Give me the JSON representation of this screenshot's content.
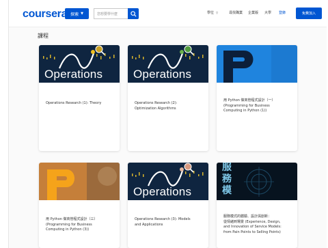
{
  "header": {
    "logo": "coursera",
    "explore_label": "探索",
    "search_placeholder": "您想要學什麼",
    "nav": [
      "學位",
      "尋找職業",
      "企業版",
      "大學",
      "登錄"
    ],
    "join_label": "免費加入"
  },
  "section": {
    "title": "課程"
  },
  "thumb_text": {
    "operations": "Operations",
    "cjk_chars": [
      "服",
      "務",
      "模"
    ]
  },
  "courses": [
    {
      "title": "Operations Research (1): Theory"
    },
    {
      "title": "Operations Research (2):\nOptimization Algorithms"
    },
    {
      "title": "用 Python 做商管程式設計（一）\n(Programming for Business\nComputing in Python (1))"
    },
    {
      "title": "用 Python 做商管程式設計（三）\n(Programming for Business\nComputing in Python (3))"
    },
    {
      "title": "Operations Research (3): Models\nand Applications"
    },
    {
      "title": "服務模式的體驗、設計與創新：\n從情緒到場景 (Experience, Design,\nand Innovation of Service Models:\nfrom Pain Points to Selling Points)"
    }
  ],
  "colors": {
    "brand": "#0056d2",
    "ops_bg": "#0f2540",
    "p_blue": "#1f84de",
    "p_orange": "#c57f3a"
  },
  "icons": [
    "chevron-down-icon",
    "search-icon",
    "magnifier-icon"
  ]
}
